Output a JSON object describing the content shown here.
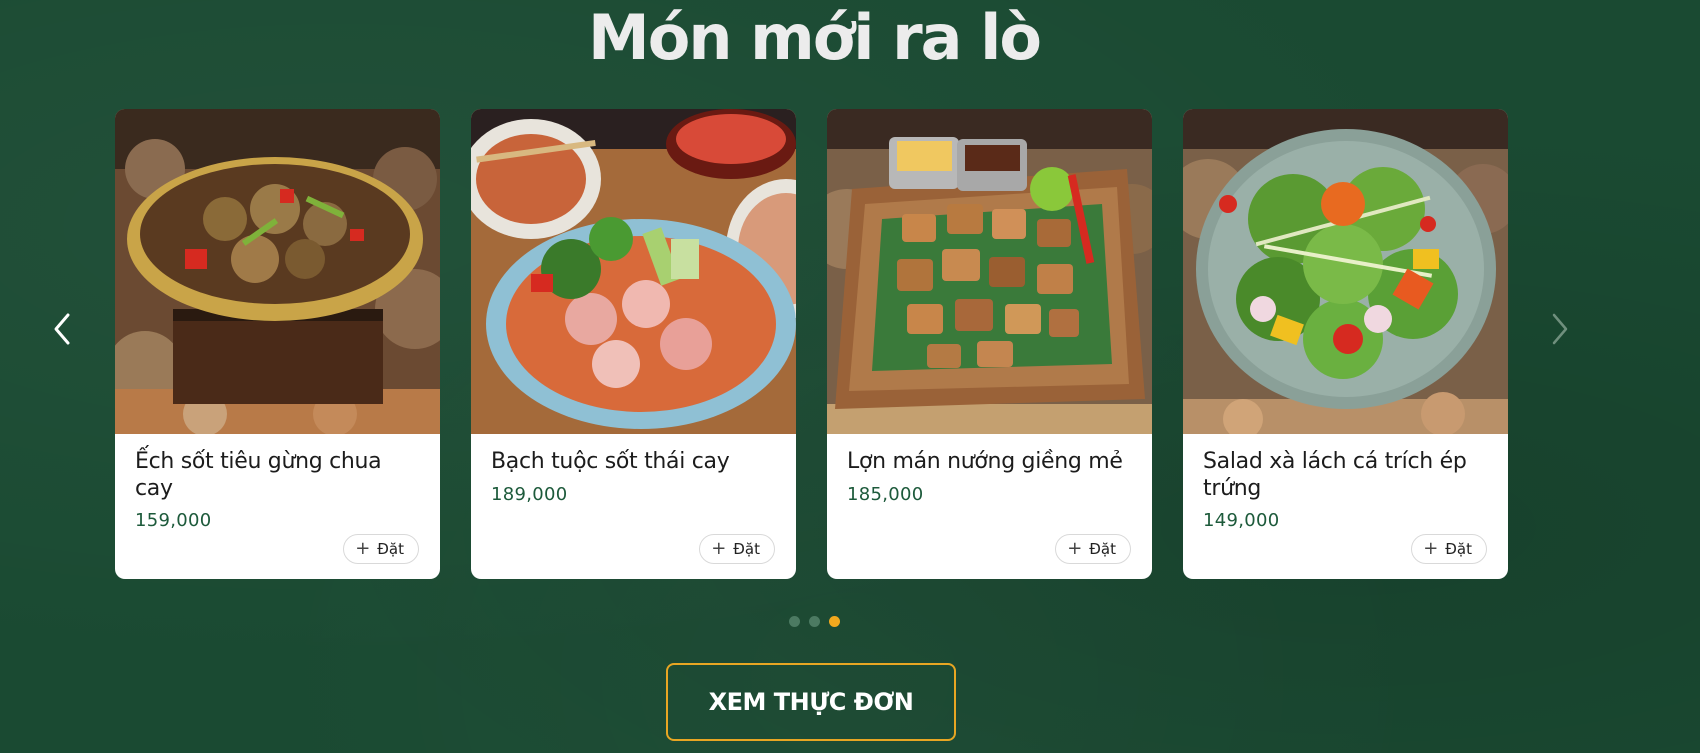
{
  "section": {
    "title": "Món mới ra lò"
  },
  "carousel": {
    "prev_icon": "chevron-left-icon",
    "next_icon": "chevron-right-icon",
    "items": [
      {
        "name": "Ếch sốt tiêu gừng chua cay",
        "price": "159,000",
        "order_label": "Đặt",
        "order_icon": "plus-icon"
      },
      {
        "name": "Bạch tuộc sốt thái cay",
        "price": "189,000",
        "order_label": "Đặt",
        "order_icon": "plus-icon"
      },
      {
        "name": "Lợn mán nướng giềng mẻ",
        "price": "185,000",
        "order_label": "Đặt",
        "order_icon": "plus-icon"
      },
      {
        "name": "Salad xà lách cá trích ép trứng",
        "price": "149,000",
        "order_label": "Đặt",
        "order_icon": "plus-icon"
      }
    ],
    "page_count": 3,
    "active_page": 3
  },
  "cta": {
    "label": "XEM THỰC ĐƠN"
  },
  "colors": {
    "background": "#1a4a32",
    "accent": "#f2a91e",
    "price": "#1d5a3b",
    "title": "#ececec"
  }
}
